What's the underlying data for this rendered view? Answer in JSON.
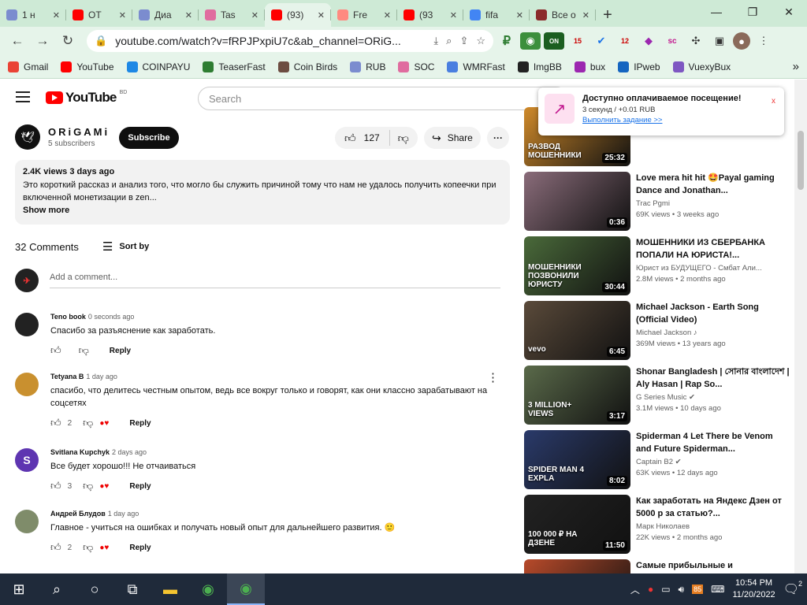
{
  "browser": {
    "tabs": [
      {
        "title": "1 н",
        "color": "#7b8ccf"
      },
      {
        "title": "OT",
        "color": "#ff0000"
      },
      {
        "title": "Диа",
        "color": "#7b8ccf"
      },
      {
        "title": "Tas",
        "color": "#e06c9f"
      },
      {
        "title": "(93)",
        "color": "#ff0000"
      },
      {
        "title": "Fre",
        "color": "#ff8a80"
      },
      {
        "title": "(93",
        "color": "#ff0000"
      },
      {
        "title": "fifa",
        "color": "#4285f4"
      },
      {
        "title": "Все о",
        "color": "#8b2b2b"
      }
    ],
    "active_tab": 4,
    "url": "youtube.com/watch?v=fRPJPxpiU7c&ab_channel=ORiG...",
    "bookmarks": [
      {
        "label": "Gmail",
        "color": "#ea4335"
      },
      {
        "label": "YouTube",
        "color": "#ff0000"
      },
      {
        "label": "COINPAYU",
        "color": "#1e88e5"
      },
      {
        "label": "TeaserFast",
        "color": "#2e7d32"
      },
      {
        "label": "Coin Birds",
        "color": "#6d4c41"
      },
      {
        "label": "RUB",
        "color": "#7b8ccf"
      },
      {
        "label": "SOC",
        "color": "#e06c9f"
      },
      {
        "label": "WMRFast",
        "color": "#4a7fe0"
      },
      {
        "label": "ImgBB",
        "color": "#222222"
      },
      {
        "label": "bux",
        "color": "#9c27b0"
      },
      {
        "label": "IPweb",
        "color": "#1565c0"
      },
      {
        "label": "VuexyBux",
        "color": "#7e57c2"
      }
    ],
    "ext_badges": {
      "on": "ON",
      "b15": "15",
      "b12": "12"
    }
  },
  "youtube": {
    "logo_text": "YouTube",
    "logo_region": "BD",
    "search_placeholder": "Search",
    "channel": {
      "name": "ORiGAMi",
      "subscribers": "5 subscribers"
    },
    "subscribe_label": "Subscribe",
    "likes": "127",
    "share_label": "Share",
    "description": {
      "meta": "2.4K views  3 days ago",
      "text": "Это короткий рассказ и анализ того, что могло бы служить причиной тому что нам не удалось получить копеечки при включенной монетизации в zen...",
      "more": "Show more"
    },
    "comments_count": "32 Comments",
    "sort_by": "Sort by",
    "add_comment_placeholder": "Add a comment...",
    "comments": [
      {
        "author": "Teno book",
        "time": "0 seconds ago",
        "text": "Спасибо за разъяснение как заработать.",
        "likes": "",
        "heart": false,
        "reply": "Reply",
        "avatar_color": "#222222",
        "initial": ""
      },
      {
        "author": "Tetyana B",
        "time": "1 day ago",
        "text": "спасибо, что делитесь честным опытом, ведь все вокруг только и говорят, как они классно зарабатывают на соцсетях",
        "likes": "2",
        "heart": true,
        "reply": "Reply",
        "avatar_color": "#c9902f",
        "initial": ""
      },
      {
        "author": "Svitlana Kupchyk",
        "time": "2 days ago",
        "text": "Все будет хорошо!!! Не отчаиваться",
        "likes": "3",
        "heart": true,
        "reply": "Reply",
        "avatar_color": "#5e35b1",
        "initial": "S"
      },
      {
        "author": "Андрей Блудов",
        "time": "1 day ago",
        "text": "Главное - учиться на ошибках и получать новый опыт для дальнейшего развития. 🙂",
        "likes": "2",
        "heart": true,
        "reply": "Reply",
        "avatar_color": "#7f8c6a",
        "initial": ""
      }
    ],
    "related": [
      {
        "title": "",
        "channel": "Хорошая Идея",
        "meta": "1.2M views • 4 months ago",
        "duration": "25:32",
        "thumb": "#d08a2a",
        "overlay": "РАЗВОД МОШЕННИКИ"
      },
      {
        "title": "Love mera hit hit 🤩Payal gaming Dance and Jonathan...",
        "channel": "Trac Pgmi",
        "meta": "69K views • 3 weeks ago",
        "duration": "0:36",
        "thumb": "#8a6c7a",
        "overlay": ""
      },
      {
        "title": "МОШЕННИКИ ИЗ СБЕРБАНКА ПОПАЛИ НА ЮРИСТА!...",
        "channel": "Юрист из БУДУЩЕГО - Смбат Али...",
        "meta": "2.8M views • 2 months ago",
        "duration": "30:44",
        "thumb": "#4a6a3a",
        "overlay": "МОШЕННИКИ ПОЗВОНИЛИ ЮРИСТУ"
      },
      {
        "title": "Michael Jackson - Earth Song (Official Video)",
        "channel": "Michael Jackson ♪",
        "meta": "369M views • 13 years ago",
        "duration": "6:45",
        "thumb": "#5a4a3a",
        "overlay": "vevo"
      },
      {
        "title": "Shonar Bangladesh | সোনার বাংলাদেশ | Aly Hasan | Rap So...",
        "channel": "G Series Music ✔",
        "meta": "3.1M views • 10 days ago",
        "duration": "3:17",
        "thumb": "#5a6a4a",
        "overlay": "3 MILLION+ VIEWS"
      },
      {
        "title": "Spiderman 4 Let There be Venom and Future Spiderman...",
        "channel": "Captain B2 ✔",
        "meta": "63K views • 12 days ago",
        "duration": "8:02",
        "thumb": "#2a3a6a",
        "overlay": "SPIDER MAN 4 EXPLA"
      },
      {
        "title": "Как заработать на Яндекс Дзен от 5000 р за статью?...",
        "channel": "Марк Николаев",
        "meta": "22K views • 2 months ago",
        "duration": "11:50",
        "thumb": "#222222",
        "overlay": "100 000 ₽ НА ДЗЕНЕ"
      },
      {
        "title": "Самые прибыльные и",
        "channel": "",
        "meta": "",
        "duration": "",
        "thumb": "#b84a2a",
        "overlay": "САМЫЕ ПРИБЫЛЬНЫЕ"
      }
    ]
  },
  "notification": {
    "title": "Доступно оплачиваемое посещение!",
    "subtitle": "3 секунд / +0.01 RUB",
    "link": "Выполнить задание >>",
    "close": "x"
  },
  "taskbar": {
    "time": "10:54 PM",
    "date": "11/20/2022",
    "notif_count": "2",
    "tray_badge": "85"
  }
}
